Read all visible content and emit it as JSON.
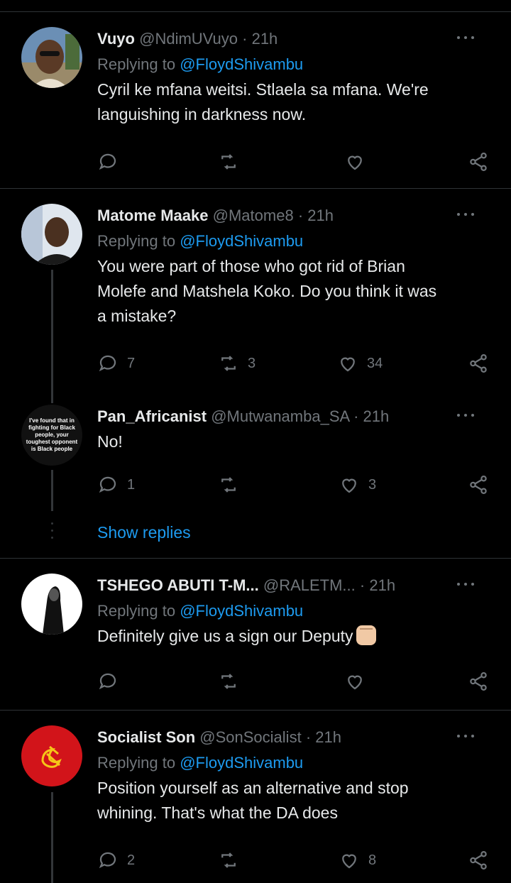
{
  "colors": {
    "background": "#000000",
    "name": "#e7e9ea",
    "muted": "#71767b",
    "link": "#1d9bf0",
    "divider": "#2f3336"
  },
  "tweets": [
    {
      "name": "Vuyo",
      "handle": "@NdimUVuyo",
      "time": "21h",
      "reply_prefix": "Replying to",
      "reply_to": "@FloydShivambu",
      "lines": [
        "Cyril ke mfana weitsi. Stlaela sa mfana. We're",
        "languishing in darkness now."
      ],
      "replies": "",
      "retweets": "",
      "likes": ""
    },
    {
      "name": "Matome Maake",
      "handle": "@Matome8",
      "time": "21h",
      "reply_prefix": "Replying to",
      "reply_to": "@FloydShivambu",
      "lines": [
        "You were part of those who got rid of Brian",
        "Molefe and Matshela Koko. Do you think it was",
        "a mistake?"
      ],
      "replies": "7",
      "retweets": "3",
      "likes": "34"
    },
    {
      "name": "Pan_Africanist",
      "handle": "@Mutwanamba_SA",
      "time": "21h",
      "avatar_text": "I've found that in fighting for Black people, your toughest opponent is Black people",
      "lines": [
        "No!"
      ],
      "replies": "1",
      "retweets": "",
      "likes": "3"
    },
    {
      "name": "TSHEGO ABUTI T-M...",
      "handle": "@RALETM...",
      "time": "21h",
      "reply_prefix": "Replying to",
      "reply_to": "@FloydShivambu",
      "lines": [
        "Definitely give us a sign our Deputy"
      ],
      "replies": "",
      "retweets": "",
      "likes": ""
    },
    {
      "name": "Socialist Son",
      "handle": "@SonSocialist",
      "time": "21h",
      "reply_prefix": "Replying to",
      "reply_to": "@FloydShivambu",
      "lines": [
        "Position yourself as an alternative and stop",
        "whining. That's what the DA does"
      ],
      "replies": "2",
      "retweets": "",
      "likes": "8"
    }
  ],
  "show_replies": "Show replies",
  "separator": "·"
}
